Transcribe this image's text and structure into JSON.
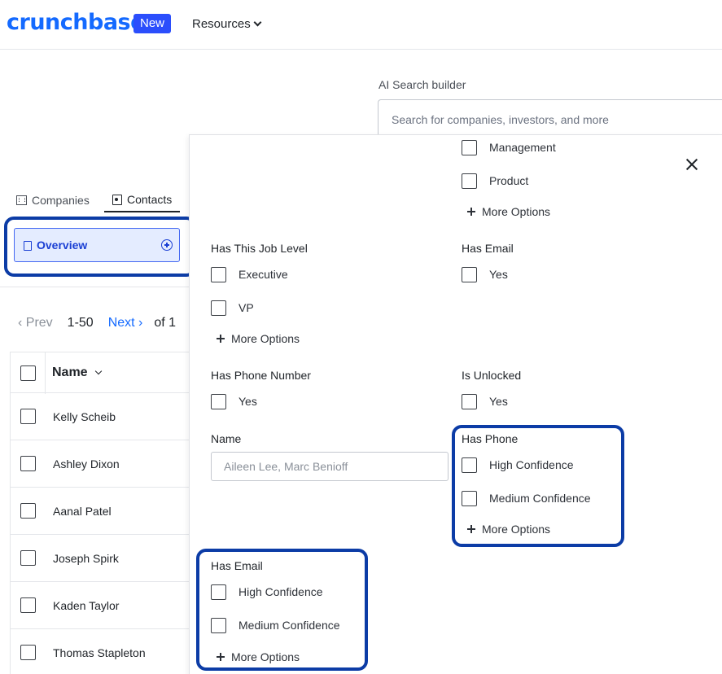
{
  "nav": {
    "logo": "crunchbase",
    "badge": "New",
    "resources": "Resources"
  },
  "ai_search": {
    "label": "AI Search builder",
    "placeholder": "Search for companies, investors, and more"
  },
  "tabs": [
    {
      "label": "Companies",
      "icon": "building-icon"
    },
    {
      "label": "Contacts",
      "icon": "contact-card-icon",
      "active": true
    }
  ],
  "overview": {
    "label": "Overview",
    "icon": "document-search-icon",
    "action_icon": "plus-circle-icon"
  },
  "pager": {
    "prev": "‹ Prev",
    "range": "1-50",
    "next": "Next ›",
    "of": "of 1"
  },
  "table": {
    "header": "Name",
    "rows": [
      "Kelly Scheib",
      "Ashley Dixon",
      "Aanal Patel",
      "Joseph Spirk",
      "Kaden Taylor",
      "Thomas Stapleton"
    ]
  },
  "filters": {
    "more_options": "More Options",
    "job_function": {
      "options": [
        "Management",
        "Product"
      ]
    },
    "job_level": {
      "title": "Has This Job Level",
      "options": [
        "Executive",
        "VP"
      ]
    },
    "has_email_yes": {
      "title": "Has Email",
      "options": [
        "Yes"
      ]
    },
    "has_phone_number": {
      "title": "Has Phone Number",
      "options": [
        "Yes"
      ]
    },
    "is_unlocked": {
      "title": "Is Unlocked",
      "options": [
        "Yes"
      ]
    },
    "name": {
      "title": "Name",
      "placeholder": "Aileen Lee, Marc Benioff",
      "value": ""
    },
    "has_phone": {
      "title": "Has Phone",
      "options": [
        "High Confidence",
        "Medium Confidence"
      ]
    },
    "has_email_confidence": {
      "title": "Has Email",
      "options": [
        "High Confidence",
        "Medium Confidence"
      ]
    }
  },
  "colors": {
    "brand": "#146aff",
    "badge": "#2b4efc",
    "highlight_frame": "#0c3ca6",
    "overview_fill": "#e4ecff"
  }
}
